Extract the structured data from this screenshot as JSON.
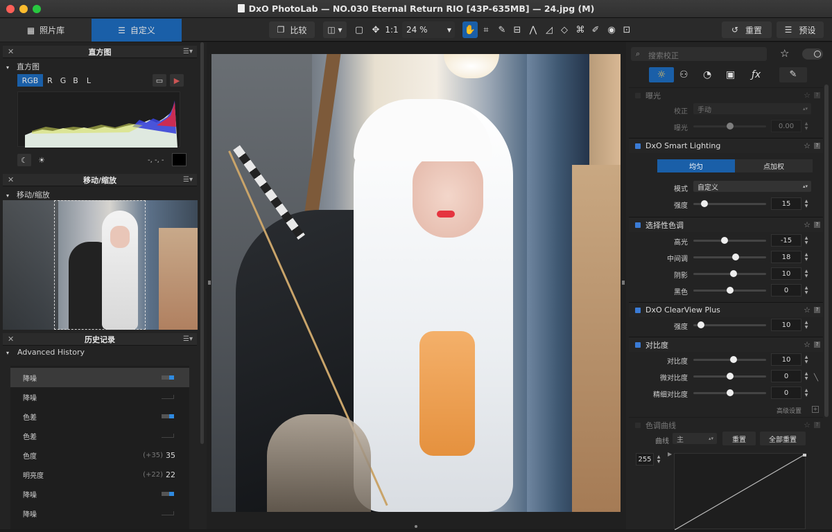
{
  "window": {
    "title": "DxO PhotoLab — NO.030 Eternal Return RIO [43P-635MB] — 24.jpg (M)"
  },
  "toolbar": {
    "tab_library": "照片库",
    "tab_customize": "自定义",
    "compare": "比较",
    "one_to_one": "1:1",
    "zoom": "24 %",
    "reset": "重置",
    "presets": "预设"
  },
  "histogram": {
    "panel_title": "直方图",
    "section": "直方图",
    "channels": [
      "RGB",
      "R",
      "G",
      "B",
      "L"
    ],
    "readout": "-, -, -"
  },
  "navigator": {
    "panel_title": "移动/缩放",
    "section": "移动/缩放"
  },
  "history": {
    "panel_title": "历史记录",
    "section": "Advanced History",
    "items": [
      {
        "label": "降噪",
        "delta": "",
        "value": "",
        "toggle": "on"
      },
      {
        "label": "降噪",
        "delta": "",
        "value": "",
        "toggle": "off"
      },
      {
        "label": "色差",
        "delta": "",
        "value": "",
        "toggle": "on"
      },
      {
        "label": "色差",
        "delta": "",
        "value": "",
        "toggle": "off"
      },
      {
        "label": "色度",
        "delta": "(+35)",
        "value": "35",
        "toggle": "none"
      },
      {
        "label": "明亮度",
        "delta": "(+22)",
        "value": "22",
        "toggle": "none"
      },
      {
        "label": "降噪",
        "delta": "",
        "value": "",
        "toggle": "on"
      },
      {
        "label": "降噪",
        "delta": "",
        "value": "",
        "toggle": "off"
      }
    ]
  },
  "right": {
    "search_placeholder": "搜索校正",
    "exposure": {
      "title": "曝光",
      "correction_label": "校正",
      "correction_value": "手动",
      "exposure_label": "曝光",
      "exposure_value": "0.00",
      "slider": 0.5
    },
    "smart_lighting": {
      "title": "DxO Smart Lighting",
      "mode_uniform": "均匀",
      "mode_spot": "点加权",
      "mode_label": "模式",
      "mode_value": "自定义",
      "strength_label": "强度",
      "strength_value": "15",
      "slider": 0.15
    },
    "selective_tone": {
      "title": "选择性色调",
      "rows": [
        {
          "label": "高光",
          "value": "-15",
          "slider": 0.43
        },
        {
          "label": "中间调",
          "value": "18",
          "slider": 0.58
        },
        {
          "label": "阴影",
          "value": "10",
          "slider": 0.55
        },
        {
          "label": "黑色",
          "value": "0",
          "slider": 0.5
        }
      ]
    },
    "clearview": {
      "title": "DxO ClearView Plus",
      "strength_label": "强度",
      "strength_value": "10",
      "slider": 0.1
    },
    "contrast": {
      "title": "对比度",
      "rows": [
        {
          "label": "对比度",
          "value": "10",
          "slider": 0.55
        },
        {
          "label": "微对比度",
          "value": "0",
          "slider": 0.5
        },
        {
          "label": "精细对比度",
          "value": "0",
          "slider": 0.5
        }
      ],
      "advanced": "高级设置"
    },
    "tone_curve": {
      "title": "色调曲线",
      "curve_label": "曲线",
      "curve_value": "主",
      "reset": "重置",
      "reset_all": "全部重置",
      "value_255": "255"
    }
  },
  "colors": {
    "accent": "#1a5fa8",
    "accent_bright": "#2f8ae0",
    "panel": "#252525"
  }
}
